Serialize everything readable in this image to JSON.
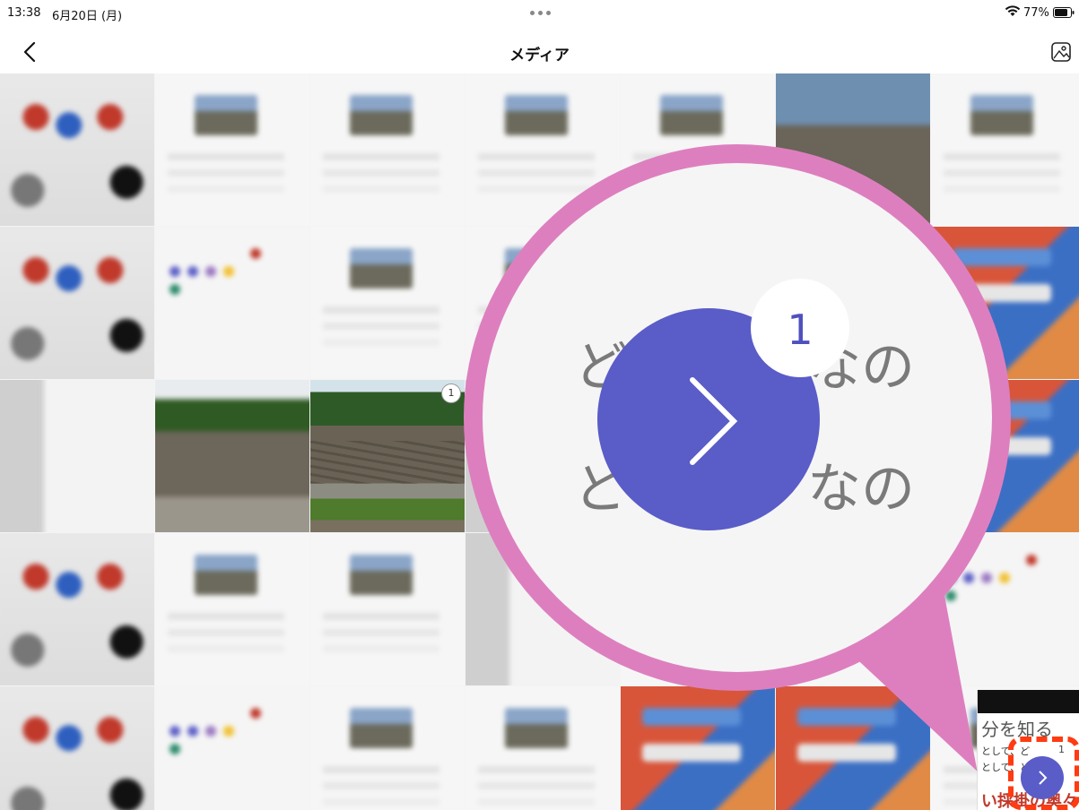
{
  "status_bar": {
    "time": "13:38",
    "date": "6月20日 (月)",
    "battery_percent": "77%"
  },
  "nav": {
    "title": "メディア"
  },
  "featured_photo": {
    "selection_number": "1"
  },
  "callout": {
    "text_top": "ど",
    "text_top_right": "なの",
    "text_bottom": "ど",
    "text_bottom_right": "なの",
    "badge_count": "1"
  },
  "corner_screenshot": {
    "heading": "分を知る",
    "line1": "として、ど",
    "line2": "として、ど",
    "count": "1",
    "red_text": "い採掛の奥々"
  },
  "colors": {
    "accent_button": "#5a5cc8",
    "callout_border": "#dd7fbf",
    "highlight_dash": "#ff3b12"
  }
}
